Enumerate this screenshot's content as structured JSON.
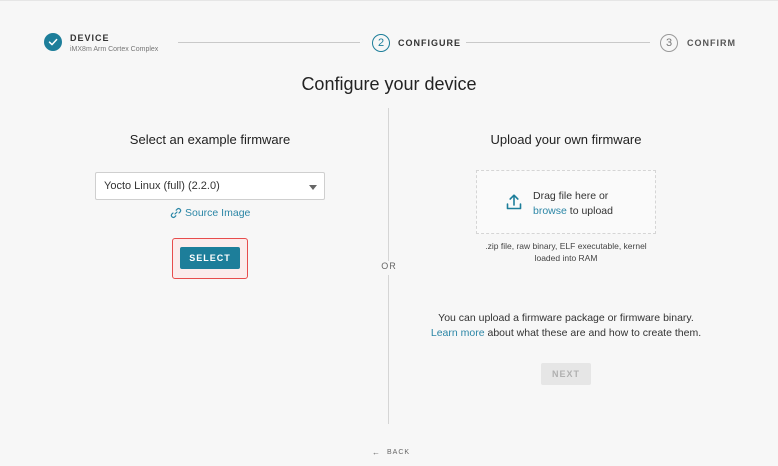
{
  "stepper": {
    "step1": {
      "label": "DEVICE",
      "sublabel": "iMX8m Arm Cortex Complex"
    },
    "step2": {
      "number": "2",
      "label": "CONFIGURE"
    },
    "step3": {
      "number": "3",
      "label": "CONFIRM"
    }
  },
  "page": {
    "title": "Configure your device"
  },
  "left": {
    "heading": "Select an example firmware",
    "firmware_select": {
      "value": "Yocto Linux (full) (2.2.0)"
    },
    "source_link": "Source Image",
    "select_button": "SELECT"
  },
  "divider": {
    "or_label": "OR"
  },
  "right": {
    "heading": "Upload your own firmware",
    "drop_line1": "Drag file here or",
    "browse_link": "browse",
    "drop_line2_suffix": " to upload",
    "file_types_line1": ".zip file, raw binary, ELF executable, kernel",
    "file_types_line2": "loaded into RAM",
    "info_line1": "You can upload a firmware package or firmware binary.",
    "learn_more": "Learn more",
    "info_line2_suffix": " about what these are and how to create them.",
    "next_button": "NEXT"
  },
  "footer": {
    "back_label": "BACK"
  },
  "colors": {
    "accent": "#1d7e9a",
    "link": "#2b86a6",
    "highlight_border": "#e74c4c",
    "disabled_bg": "#e6e6e6"
  },
  "icons": {
    "step_done": "checkmark-icon",
    "source_link": "link-icon",
    "upload": "upload-icon",
    "back": "arrow-left-icon",
    "dropdown": "chevron-down-icon"
  }
}
